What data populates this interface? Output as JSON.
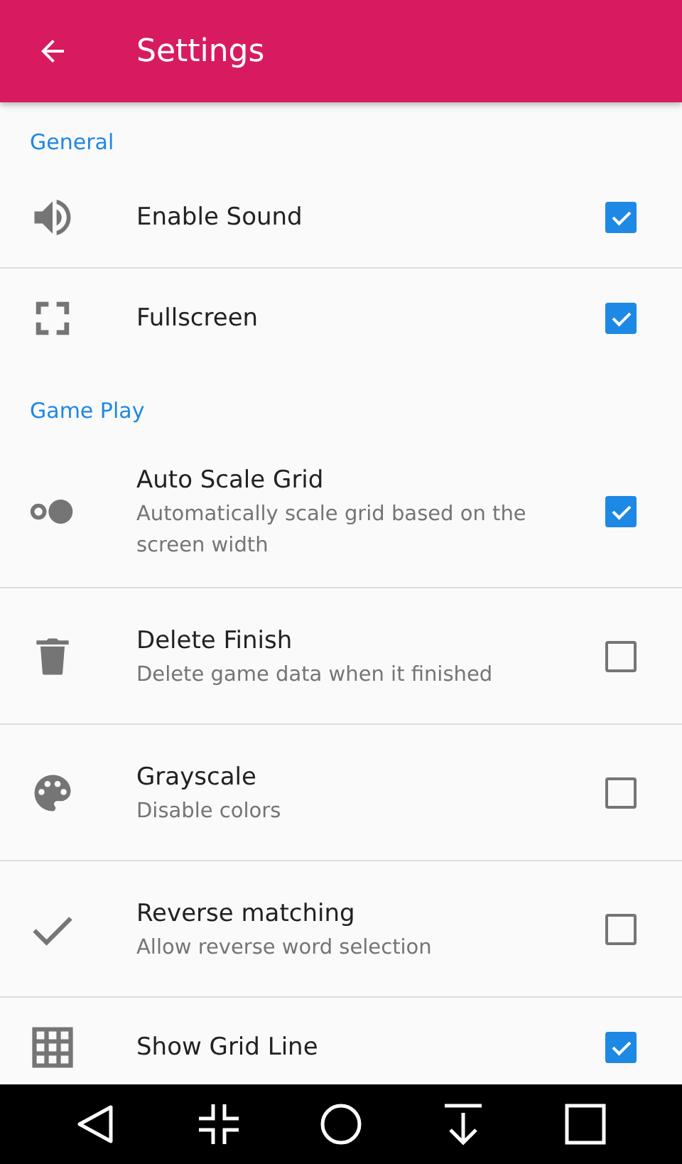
{
  "app_bar": {
    "title": "Settings"
  },
  "sections": [
    {
      "header": "General",
      "items": [
        {
          "title": "Enable Sound",
          "checked": true
        },
        {
          "title": "Fullscreen",
          "checked": true
        }
      ]
    },
    {
      "header": "Game Play",
      "items": [
        {
          "title": "Auto Scale Grid",
          "summary": "Automatically scale grid based on the screen width",
          "checked": true
        },
        {
          "title": "Delete Finish",
          "summary": "Delete game data when it finished",
          "checked": false
        },
        {
          "title": "Grayscale",
          "summary": "Disable colors",
          "checked": false
        },
        {
          "title": "Reverse matching",
          "summary": "Allow reverse word selection",
          "checked": false
        },
        {
          "title": "Show Grid Line",
          "checked": true
        }
      ]
    }
  ]
}
